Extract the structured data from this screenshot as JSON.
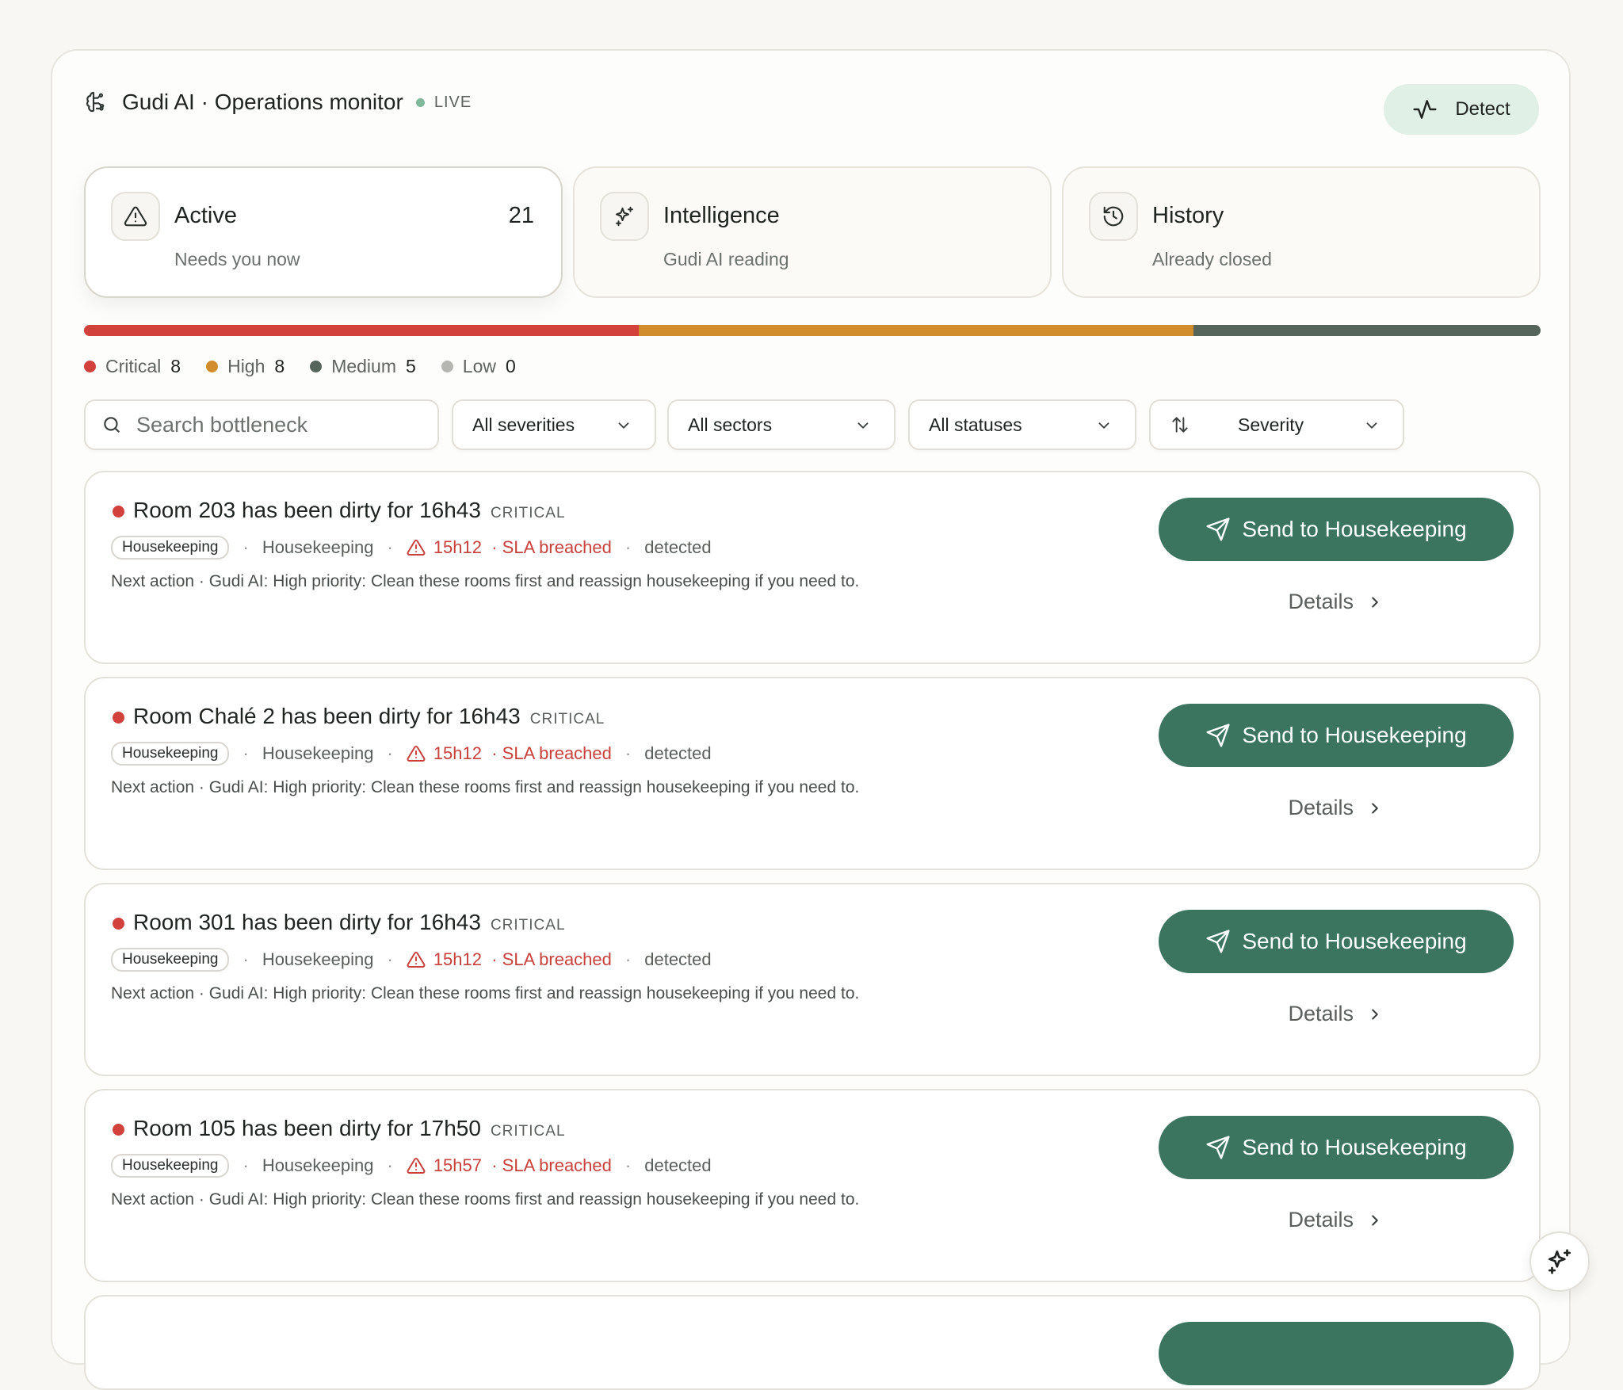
{
  "header": {
    "title": "Gudi AI · Operations monitor",
    "live": "LIVE",
    "detect_label": "Detect",
    "icon": "brain-icon"
  },
  "tabs": [
    {
      "title": "Active",
      "subtitle": "Needs you now",
      "count": "21",
      "icon": "alert-triangle-icon",
      "active": true
    },
    {
      "title": "Intelligence",
      "subtitle": "Gudi AI reading",
      "count": "",
      "icon": "sparkles-icon",
      "active": false
    },
    {
      "title": "History",
      "subtitle": "Already closed",
      "count": "",
      "icon": "history-icon",
      "active": false
    }
  ],
  "severity_summary": {
    "colors": {
      "critical": "#d2413b",
      "high": "#d18d2b",
      "medium": "#55655c",
      "low": "#b5b5b2"
    },
    "items": [
      {
        "label": "Critical",
        "count": "8"
      },
      {
        "label": "High",
        "count": "8"
      },
      {
        "label": "Medium",
        "count": "5"
      },
      {
        "label": "Low",
        "count": "0"
      }
    ]
  },
  "filters": {
    "search_placeholder": "Search bottleneck",
    "severity": "All severities",
    "sector": "All sectors",
    "status": "All statuses",
    "sort": "Severity"
  },
  "cards": [
    {
      "title": "Room 203 has been dirty for 16h43",
      "severity": "CRITICAL",
      "chip": "Housekeeping",
      "sector": "Housekeeping",
      "time": "15h12",
      "sla": "· SLA breached",
      "status": "detected",
      "next": "Next action · Gudi AI: High priority: Clean these rooms first and reassign housekeeping if you need to.",
      "send_label": "Send to Housekeeping",
      "details_label": "Details"
    },
    {
      "title": "Room Chalé 2 has been dirty for 16h43",
      "severity": "CRITICAL",
      "chip": "Housekeeping",
      "sector": "Housekeeping",
      "time": "15h12",
      "sla": "· SLA breached",
      "status": "detected",
      "next": "Next action · Gudi AI: High priority: Clean these rooms first and reassign housekeeping if you need to.",
      "send_label": "Send to Housekeeping",
      "details_label": "Details"
    },
    {
      "title": "Room 301 has been dirty for 16h43",
      "severity": "CRITICAL",
      "chip": "Housekeeping",
      "sector": "Housekeeping",
      "time": "15h12",
      "sla": "· SLA breached",
      "status": "detected",
      "next": "Next action · Gudi AI: High priority: Clean these rooms first and reassign housekeeping if you need to.",
      "send_label": "Send to Housekeeping",
      "details_label": "Details"
    },
    {
      "title": "Room 105 has been dirty for 17h50",
      "severity": "CRITICAL",
      "chip": "Housekeeping",
      "sector": "Housekeeping",
      "time": "15h57",
      "sla": "· SLA breached",
      "status": "detected",
      "next": "Next action · Gudi AI: High priority: Clean these rooms first and reassign housekeeping if you need to.",
      "send_label": "Send to Housekeeping",
      "details_label": "Details"
    }
  ],
  "fab_icon": "sparkles-icon"
}
